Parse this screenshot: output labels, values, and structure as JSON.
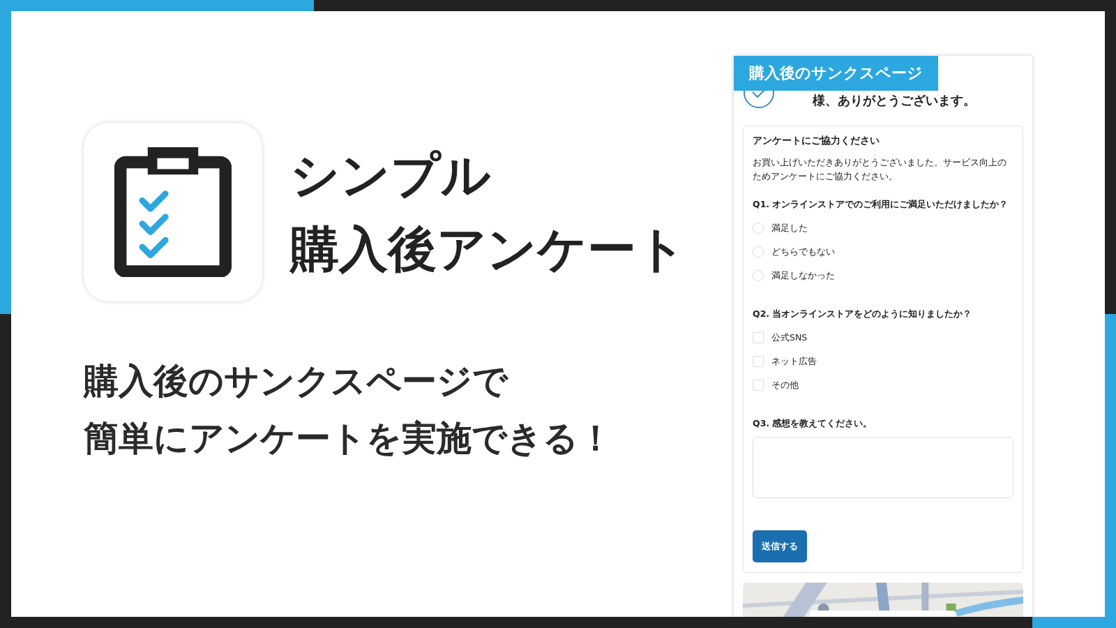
{
  "title_lines": [
    "シンプル",
    "購入後アンケート"
  ],
  "subtitle_lines": [
    "購入後のサンクスページで",
    "簡単にアンケートを実施できる！"
  ],
  "preview": {
    "tag": "購入後のサンクスページ",
    "thanks": "様、ありがとうございます。",
    "survey": {
      "title": "アンケートにご協力ください",
      "intro": "お買い上げいただきありがとうございました。サービス向上のためアンケートにご協力ください。",
      "questions": [
        {
          "kind": "radio",
          "label": "Q1. オンラインストアでのご利用にご満足いただけましたか？",
          "options": [
            {
              "label": "満足した",
              "selected": false
            },
            {
              "label": "どちらでもない",
              "selected": false
            },
            {
              "label": "満足しなかった",
              "selected": false
            }
          ]
        },
        {
          "kind": "checkbox",
          "label": "Q2. 当オンラインストアをどのように知りましたか？",
          "options": [
            {
              "label": "公式SNS",
              "checked": false
            },
            {
              "label": "ネット広告",
              "checked": false
            },
            {
              "label": "その他",
              "checked": false
            }
          ]
        },
        {
          "kind": "text",
          "label": "Q3. 感想を教えてください。"
        }
      ],
      "submit": "送信する"
    }
  }
}
